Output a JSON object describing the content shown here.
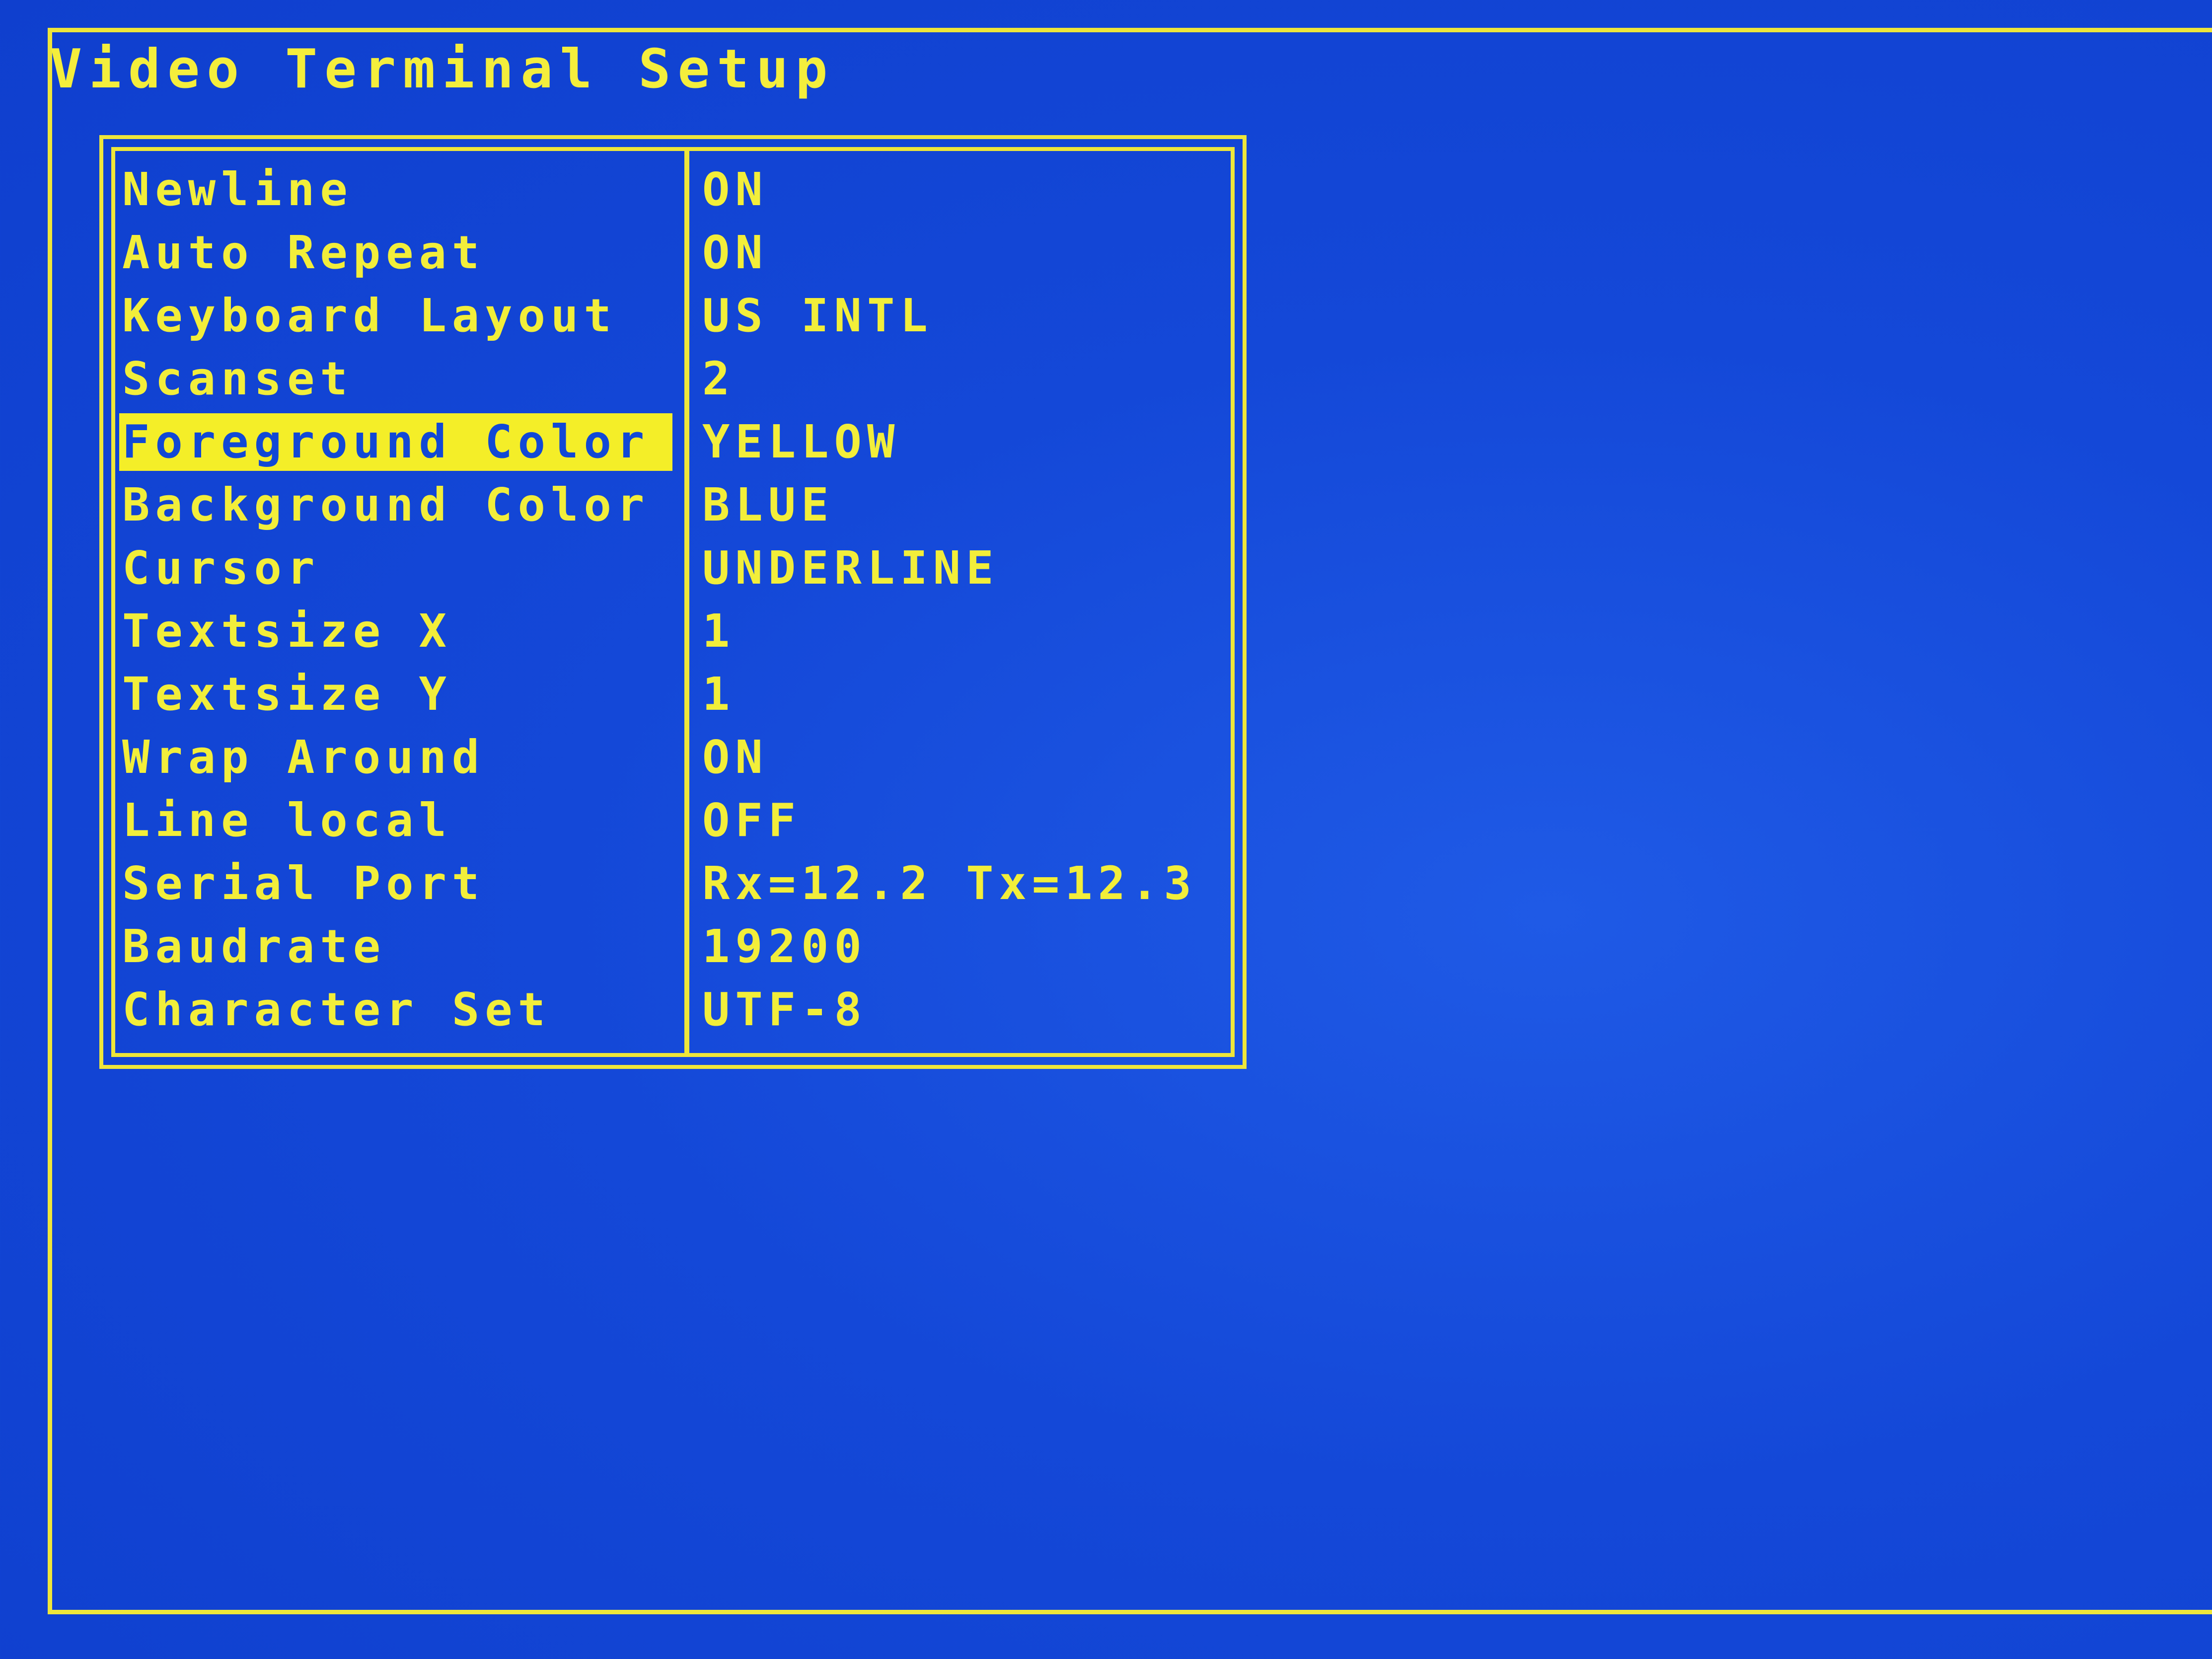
{
  "screen": {
    "title": "Video Terminal Setup"
  },
  "settings": [
    {
      "label": "Newline",
      "value": "ON"
    },
    {
      "label": "Auto Repeat",
      "value": "ON"
    },
    {
      "label": "Keyboard Layout",
      "value": "US INTL"
    },
    {
      "label": "Scanset",
      "value": "2"
    },
    {
      "label": "Foreground Color",
      "value": "YELLOW"
    },
    {
      "label": "Background Color",
      "value": "BLUE"
    },
    {
      "label": "Cursor",
      "value": "UNDERLINE"
    },
    {
      "label": "Textsize X",
      "value": "1"
    },
    {
      "label": "Textsize Y",
      "value": "1"
    },
    {
      "label": "Wrap Around",
      "value": "ON"
    },
    {
      "label": "Line local",
      "value": "OFF"
    },
    {
      "label": "Serial Port",
      "value": "Rx=12.2 Tx=12.3"
    },
    {
      "label": "Baudrate",
      "value": "19200"
    },
    {
      "label": "Character Set",
      "value": "UTF-8"
    }
  ],
  "selected_index": 4,
  "colors": {
    "background": "#1448d8",
    "foreground": "#f2ee3a",
    "selection_background": "#f4ee28",
    "selection_text": "#1148d6"
  }
}
